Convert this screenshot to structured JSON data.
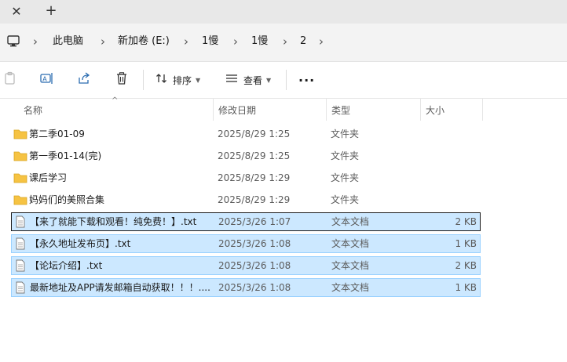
{
  "tabbar": {
    "close_glyph": "✕",
    "new_tab_glyph": "+"
  },
  "address": {
    "icon": "computer-icon",
    "separator": "›",
    "crumbs": [
      "此电脑",
      "新加卷 (E:)",
      "1慢",
      "1慢",
      "2"
    ]
  },
  "toolbar": {
    "sort_label": "排序",
    "view_label": "查看",
    "more_label": "···",
    "icons": [
      "paste-icon",
      "rename-icon",
      "share-icon",
      "delete-icon",
      "sort-icon",
      "view-icon",
      "more-icon"
    ]
  },
  "columns": {
    "name": "名称",
    "date": "修改日期",
    "type": "类型",
    "size": "大小",
    "sort_arrow": "^"
  },
  "files": [
    {
      "name": "第二季01-09",
      "date": "2025/8/29 1:25",
      "type": "文件夹",
      "size": "",
      "kind": "folder",
      "selected": false
    },
    {
      "name": "第一季01-14(完)",
      "date": "2025/8/29 1:25",
      "type": "文件夹",
      "size": "",
      "kind": "folder",
      "selected": false
    },
    {
      "name": "课后学习",
      "date": "2025/8/29 1:29",
      "type": "文件夹",
      "size": "",
      "kind": "folder",
      "selected": false
    },
    {
      "name": "妈妈们的美照合集",
      "date": "2025/8/29 1:29",
      "type": "文件夹",
      "size": "",
      "kind": "folder",
      "selected": false
    },
    {
      "name": "【来了就能下载和观看！纯免费！】.txt",
      "date": "2025/3/26 1:07",
      "type": "文本文档",
      "size": "2 KB",
      "kind": "text",
      "selected": true,
      "focused": true
    },
    {
      "name": "【永久地址发布页】.txt",
      "date": "2025/3/26 1:08",
      "type": "文本文档",
      "size": "1 KB",
      "kind": "text",
      "selected": true
    },
    {
      "name": "【论坛介绍】.txt",
      "date": "2025/3/26 1:08",
      "type": "文本文档",
      "size": "2 KB",
      "kind": "text",
      "selected": true
    },
    {
      "name": "最新地址及APP请发邮箱自动获取！！！....",
      "date": "2025/3/26 1:08",
      "type": "文本文档",
      "size": "1 KB",
      "kind": "text",
      "selected": true
    }
  ],
  "colors": {
    "folder": "#f6c343",
    "selection": "#cce8ff",
    "selection_border": "#99d1ff"
  }
}
